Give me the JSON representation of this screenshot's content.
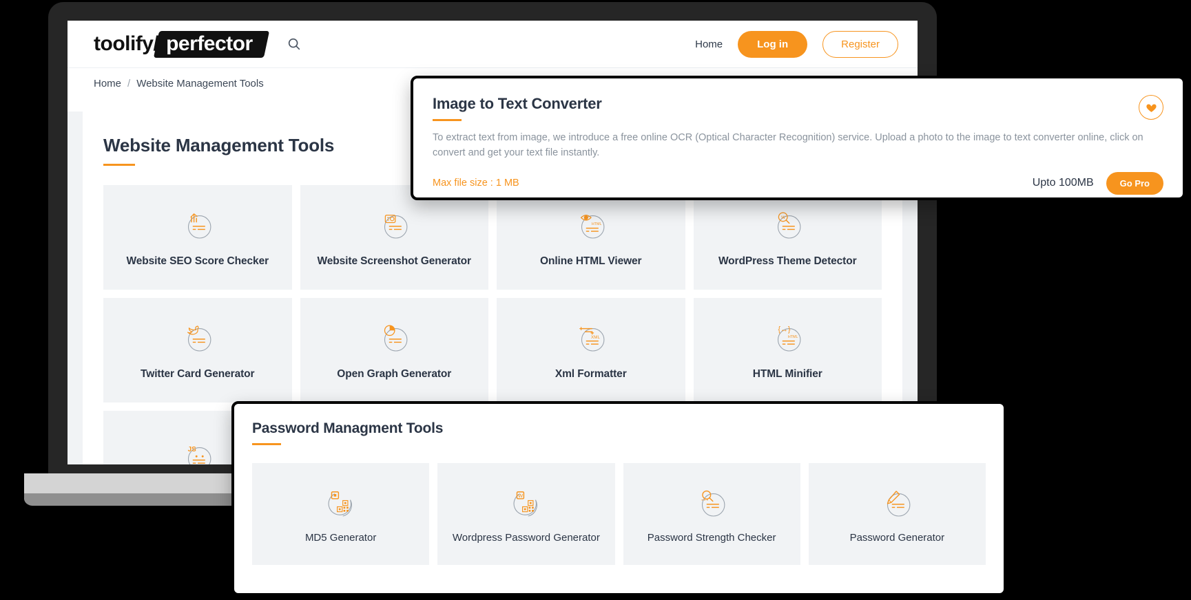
{
  "header": {
    "logo_primary": "toolify",
    "logo_slash": "/",
    "logo_secondary": "perfector",
    "search_icon": "search-icon",
    "nav": {
      "home": "Home",
      "login": "Log in",
      "register": "Register"
    }
  },
  "breadcrumb": {
    "home": "Home",
    "separator": "/",
    "current": "Website Management Tools"
  },
  "main": {
    "section_title": "Website Management Tools",
    "tools": [
      {
        "label": "Website SEO Score Checker",
        "icon": "seo-score-chart-icon"
      },
      {
        "label": "Website Screenshot Generator",
        "icon": "screenshot-camera-icon"
      },
      {
        "label": "Online HTML Viewer",
        "icon": "html-eye-viewer-icon"
      },
      {
        "label": "WordPress Theme Detector",
        "icon": "wordpress-magnifier-icon"
      },
      {
        "label": "Twitter Card Generator",
        "icon": "twitter-bird-icon"
      },
      {
        "label": "Open Graph Generator",
        "icon": "open-graph-pie-icon"
      },
      {
        "label": "Xml Formatter",
        "icon": "xml-format-icon"
      },
      {
        "label": "HTML Minifier",
        "icon": "html-minify-braces-icon"
      },
      {
        "label": "",
        "icon": "js-obfuscator-icon"
      }
    ]
  },
  "image_to_text_panel": {
    "title": "Image to Text Converter",
    "description": "To extract text from image, we introduce a free online OCR (Optical Character Recognition) service. Upload a photo to the image to text converter online, click on convert and get your text file instantly.",
    "max_file_size": "Max file size : 1 MB",
    "upto": "Upto 100MB",
    "go_pro": "Go Pro",
    "favorite_icon": "heart-icon"
  },
  "password_panel": {
    "title": "Password Managment Tools",
    "tools": [
      {
        "label": "MD5 Generator",
        "icon": "md5-qr-icon"
      },
      {
        "label": "Wordpress Password Generator",
        "icon": "wordpress-qr-icon"
      },
      {
        "label": "Password Strength Checker",
        "icon": "password-magnifier-icon"
      },
      {
        "label": "Password Generator",
        "icon": "password-pencil-icon"
      }
    ]
  },
  "colors": {
    "accent": "#f7941e",
    "text_dark": "#2b3545",
    "text_muted": "#8a939d",
    "card_bg": "#f1f3f5",
    "bezel": "#262626"
  }
}
